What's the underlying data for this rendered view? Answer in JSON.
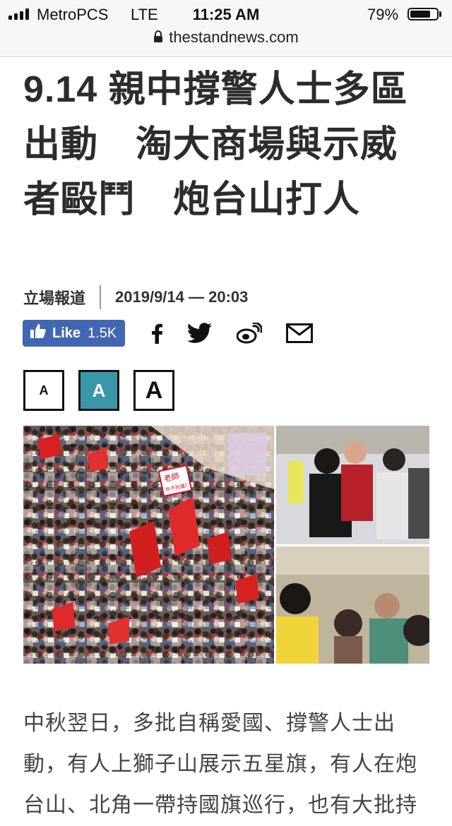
{
  "status_bar": {
    "carrier": "MetroPCS",
    "network": "LTE",
    "time": "11:25 AM",
    "battery_percent": "79%",
    "battery_level": 0.79,
    "signal_bars": 4
  },
  "browser": {
    "url": "thestandnews.com",
    "lock_icon": "lock-icon"
  },
  "article": {
    "title": "9.14 親中撐警人士多區出動　淘大商場與示威者毆鬥　炮台山打人",
    "source": "立場報道",
    "datetime": "2019/9/14 — 20:03",
    "body_first_lines": "中秋翌日，多批自稱愛國、撐警人士出動，有人上獅子山展示五星旗，有人在炮台山、北角一帶持國旗巡行，也有大批持"
  },
  "share": {
    "like_label": "Like",
    "like_count": "1.5K",
    "icons": [
      "facebook-icon",
      "twitter-icon",
      "weibo-icon",
      "email-icon"
    ]
  },
  "font_size_buttons": [
    {
      "label": "A",
      "size": "small",
      "active": false
    },
    {
      "label": "A",
      "size": "medium",
      "active": true
    },
    {
      "label": "A",
      "size": "large",
      "active": false
    }
  ],
  "photo": {
    "description_icon": "news-photo-collage",
    "sign_text_line1": "老師",
    "sign_text_line2": "你不抗議?"
  },
  "colors": {
    "facebook_blue": "#4267b2",
    "active_font_button": "#3a97a8",
    "title_text": "#2c2c2c"
  }
}
